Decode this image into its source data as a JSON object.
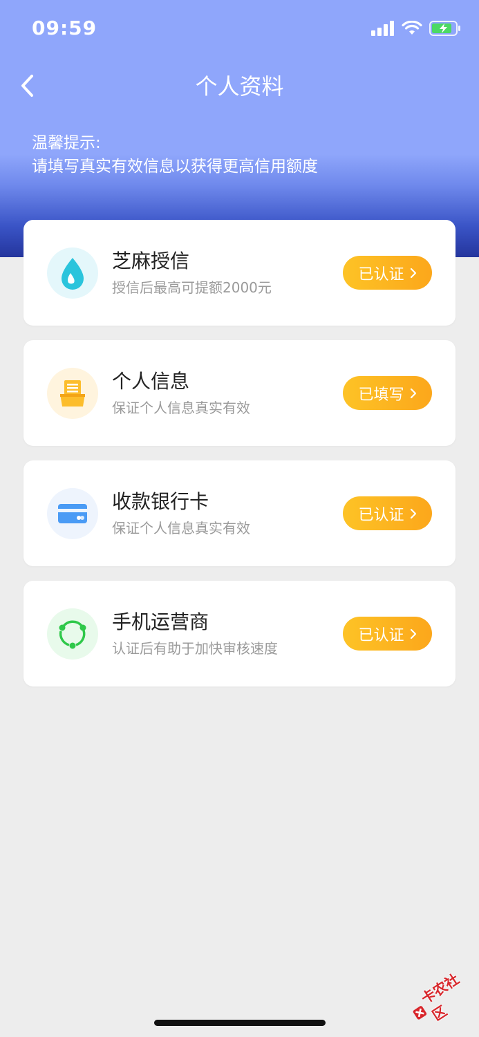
{
  "status_bar": {
    "time": "09:59"
  },
  "nav": {
    "title": "个人资料"
  },
  "tip": {
    "line1": "温馨提示:",
    "line2": "请填写真实有效信息以获得更高信用额度"
  },
  "cards": [
    {
      "title": "芝麻授信",
      "subtitle": "授信后最高可提额2000元",
      "button": "已认证",
      "icon": "sesame-drop-icon",
      "icon_bg": "#e4f7fb",
      "icon_color": "#2bc4dc"
    },
    {
      "title": "个人信息",
      "subtitle": "保证个人信息真实有效",
      "button": "已填写",
      "icon": "id-box-icon",
      "icon_bg": "#fff4de",
      "icon_color": "#fcbd2c"
    },
    {
      "title": "收款银行卡",
      "subtitle": "保证个人信息真实有效",
      "button": "已认证",
      "icon": "bank-card-icon",
      "icon_bg": "#eef4fd",
      "icon_color": "#4a9bf5"
    },
    {
      "title": "手机运营商",
      "subtitle": "认证后有助于加快审核速度",
      "button": "已认证",
      "icon": "carrier-cycle-icon",
      "icon_bg": "#e8faeb",
      "icon_color": "#2fc84a"
    }
  ],
  "watermark": {
    "text": "卡农社区"
  },
  "colors": {
    "header": "#8fa6fb",
    "button": "#fcb520",
    "background": "#ededed"
  }
}
